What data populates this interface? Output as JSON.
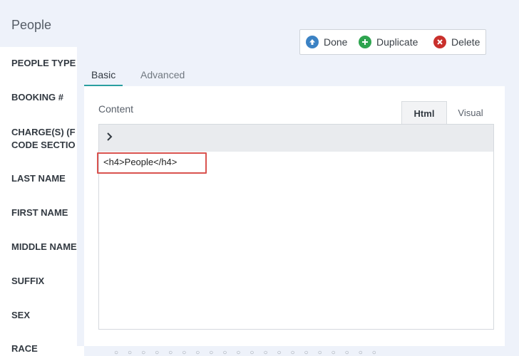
{
  "page": {
    "title": "People"
  },
  "fields": [
    {
      "label": "PEOPLE TYPE"
    },
    {
      "label": "BOOKING #"
    },
    {
      "label": "CHARGE(S) (F"
    },
    {
      "label": "CODE SECTIO"
    },
    {
      "label": "LAST NAME"
    },
    {
      "label": "FIRST NAME"
    },
    {
      "label": "MIDDLE NAME"
    },
    {
      "label": "SUFFIX"
    },
    {
      "label": "SEX"
    },
    {
      "label": "RACE"
    }
  ],
  "toolbar": {
    "done_label": "Done",
    "duplicate_label": "Duplicate",
    "delete_label": "Delete"
  },
  "tabs": {
    "basic": "Basic",
    "advanced": "Advanced"
  },
  "content": {
    "label": "Content",
    "mode_html": "Html",
    "mode_visual": "Visual",
    "code": "<h4>People</h4>"
  },
  "colors": {
    "accent_teal": "#2a9fa0",
    "done_blue": "#3b82c4",
    "duplicate_green": "#2ea44f",
    "delete_red": "#c9302c",
    "highlight_red": "#d9534f"
  }
}
